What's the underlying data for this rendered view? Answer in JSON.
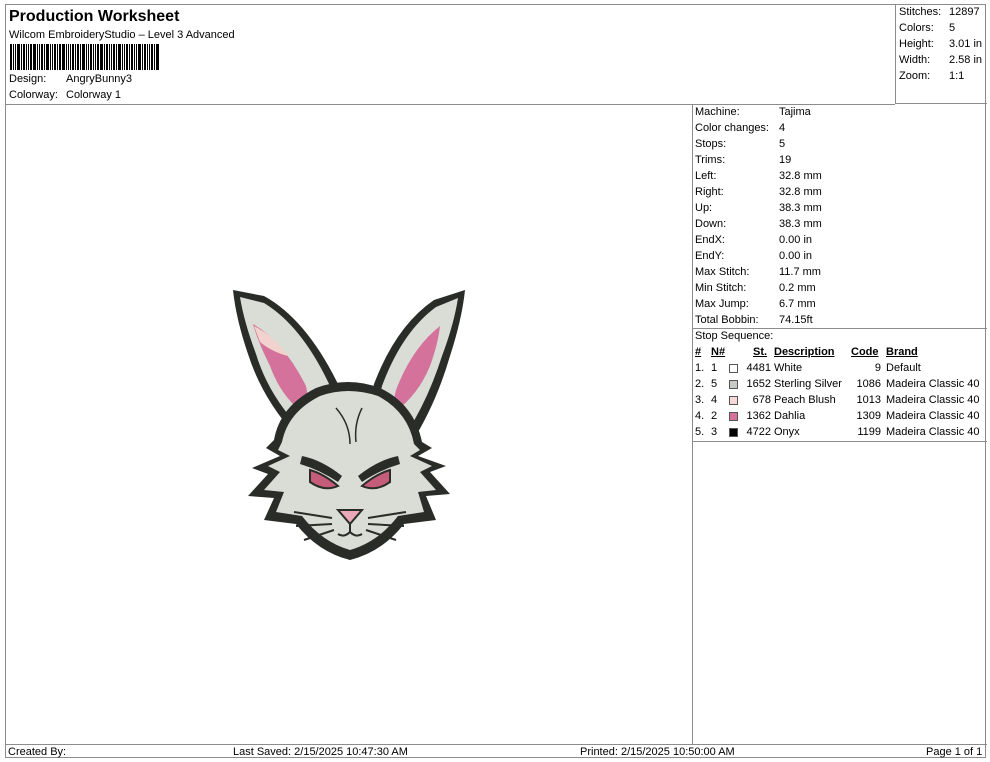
{
  "header": {
    "title": "Production Worksheet",
    "subtitle": "Wilcom EmbroideryStudio – Level 3 Advanced",
    "design_label": "Design:",
    "design_value": "AngryBunny3",
    "colorway_label": "Colorway:",
    "colorway_value": "Colorway 1"
  },
  "stats": [
    {
      "label": "Stitches:",
      "value": "12897"
    },
    {
      "label": "Colors:",
      "value": "5"
    },
    {
      "label": "Height:",
      "value": "3.01 in"
    },
    {
      "label": "Width:",
      "value": "2.58 in"
    },
    {
      "label": "Zoom:",
      "value": "1:1"
    }
  ],
  "machine_info": [
    {
      "label": "Machine:",
      "value": "Tajima"
    },
    {
      "label": "Color changes:",
      "value": "4"
    },
    {
      "label": "Stops:",
      "value": "5"
    },
    {
      "label": "Trims:",
      "value": "19"
    },
    {
      "label": "Left:",
      "value": "32.8 mm"
    },
    {
      "label": "Right:",
      "value": "32.8 mm"
    },
    {
      "label": "Up:",
      "value": "38.3 mm"
    },
    {
      "label": "Down:",
      "value": "38.3 mm"
    },
    {
      "label": "EndX:",
      "value": "0.00 in"
    },
    {
      "label": "EndY:",
      "value": "0.00 in"
    },
    {
      "label": "Max Stitch:",
      "value": "11.7 mm"
    },
    {
      "label": "Min Stitch:",
      "value": "0.2 mm"
    },
    {
      "label": "Max Jump:",
      "value": "6.7 mm"
    },
    {
      "label": "Total Bobbin:",
      "value": "74.15ft"
    }
  ],
  "stop_sequence": {
    "title": "Stop Sequence:",
    "headers": {
      "num": "#",
      "n": "N#",
      "st": "St.",
      "description": "Description",
      "code": "Code",
      "brand": "Brand"
    },
    "rows": [
      {
        "num": "1.",
        "n": "1",
        "color": "#ffffff",
        "st": "4481",
        "description": "White",
        "code": "9",
        "brand": "Default"
      },
      {
        "num": "2.",
        "n": "5",
        "color": "#c8cac6",
        "st": "1652",
        "description": "Sterling Silver",
        "code": "1086",
        "brand": "Madeira Classic 40"
      },
      {
        "num": "3.",
        "n": "4",
        "color": "#f6d9d6",
        "st": "678",
        "description": "Peach Blush",
        "code": "1013",
        "brand": "Madeira Classic 40"
      },
      {
        "num": "4.",
        "n": "2",
        "color": "#d4729c",
        "st": "1362",
        "description": "Dahlia",
        "code": "1309",
        "brand": "Madeira Classic 40"
      },
      {
        "num": "5.",
        "n": "3",
        "color": "#000000",
        "st": "4722",
        "description": "Onyx",
        "code": "1199",
        "brand": "Madeira Classic 40"
      }
    ]
  },
  "footer": {
    "created_by": "Created By:",
    "last_saved": "Last Saved: 2/15/2025 10:47:30 AM",
    "printed": "Printed: 2/15/2025 10:50:00 AM",
    "page": "Page 1 of 1"
  },
  "colors": {
    "fur": "#d9ddd6",
    "outline": "#2a2c28",
    "ear_inner": "#d4729c",
    "ear_light": "#f2d2cd",
    "nose": "#e9a9b8",
    "eye": "#c45c7a"
  }
}
